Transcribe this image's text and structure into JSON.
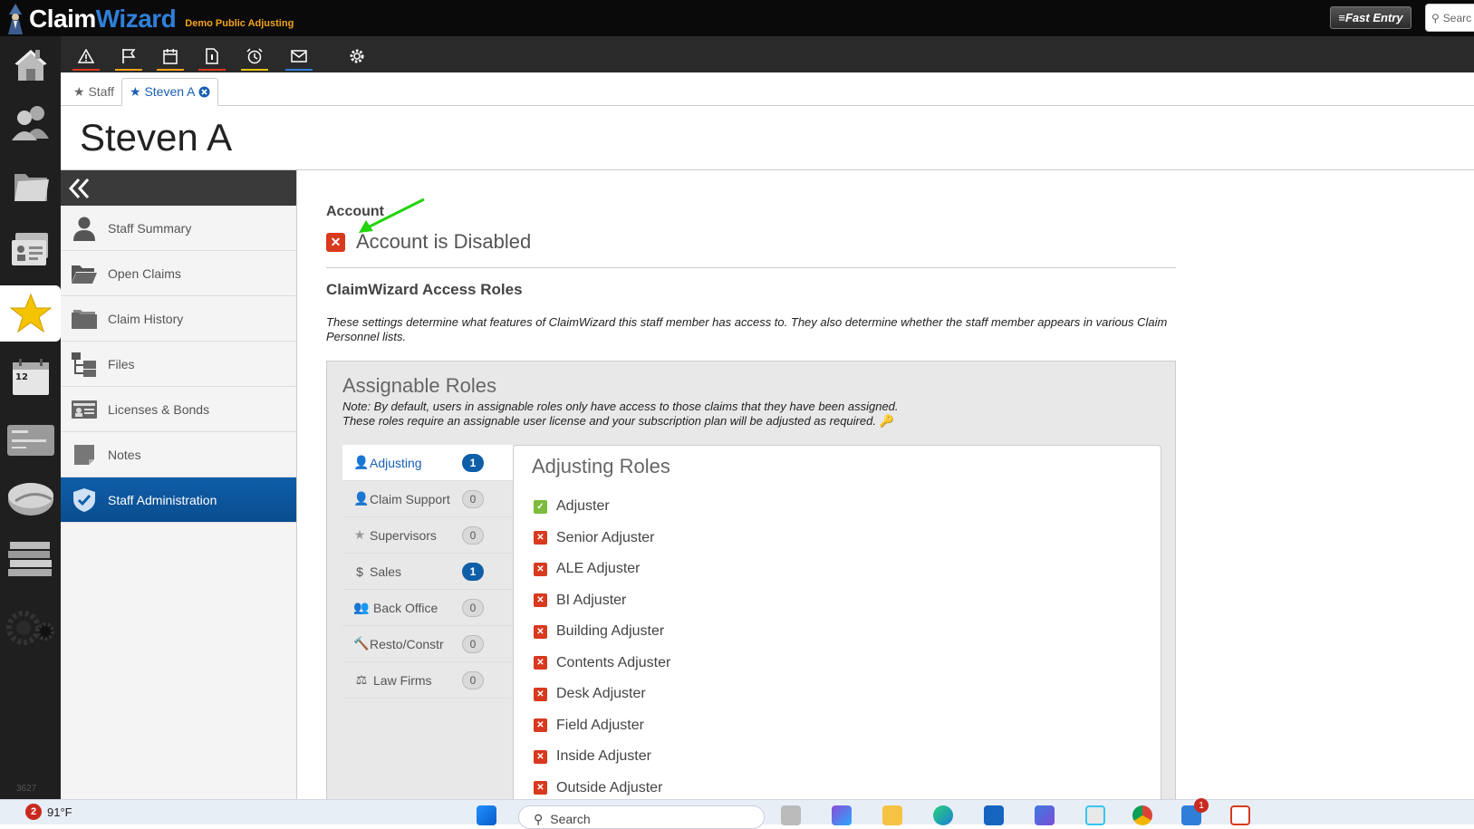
{
  "app": {
    "brand_part1": "Claim",
    "brand_part2": "Wizard",
    "company": "Demo Public Adjusting",
    "fast_entry_label": "≡Fast Entry",
    "search_placeholder": "Searc"
  },
  "left_nav": {
    "items": [
      "home-icon",
      "people-icon",
      "folder-icon",
      "contacts-icon",
      "star-icon",
      "calendar-icon",
      "bank-card-icon",
      "disk-icon",
      "books-icon",
      "gears-icon"
    ],
    "active": "star-icon",
    "calendar_day": "12",
    "version": "3627"
  },
  "toolbar": {
    "icons": [
      "alert-icon",
      "flag-icon",
      "calendar-icon",
      "document-icon",
      "alarm-icon",
      "mail-icon",
      "settings-icon"
    ],
    "colors": [
      "#d8391f",
      "#f2a31a",
      "#f2a31a",
      "#d8391f",
      "#e6c200",
      "#2f7fd8"
    ]
  },
  "tabs": {
    "staff_label": "★ Staff",
    "current_label": "★ Steven A"
  },
  "page_title": "Steven A",
  "side_menu": {
    "items": [
      {
        "label": "Staff Summary",
        "icon": "person-icon"
      },
      {
        "label": "Open Claims",
        "icon": "open-folder-icon"
      },
      {
        "label": "Claim History",
        "icon": "folders-icon"
      },
      {
        "label": "Files",
        "icon": "file-tree-icon"
      },
      {
        "label": "Licenses & Bonds",
        "icon": "id-card-icon"
      },
      {
        "label": "Notes",
        "icon": "note-icon"
      },
      {
        "label": "Staff Administration",
        "icon": "shield-check-icon"
      }
    ],
    "active_index": 6
  },
  "account": {
    "heading": "Account",
    "status": "Account is Disabled",
    "status_color": "#d8391f"
  },
  "access_roles": {
    "heading": "ClaimWizard Access Roles",
    "description": "These settings determine what features of ClaimWizard this staff member has access to. They also determine whether the staff member appears in various Claim Personnel lists."
  },
  "assignable": {
    "heading": "Assignable Roles",
    "note1": "Note: By default, users in assignable roles only have access to those claims that they have been assigned.",
    "note2": "These roles require an assignable user license and your subscription plan will be adjusted as required.",
    "tabs": [
      {
        "label": "Adjusting",
        "icon": "person-icon",
        "count": "1",
        "active": true
      },
      {
        "label": "Claim Support",
        "icon": "person-icon",
        "count": "0",
        "active": false
      },
      {
        "label": "Supervisors",
        "icon": "star-icon",
        "count": "0",
        "active": false
      },
      {
        "label": "Sales",
        "icon": "dollar-icon",
        "count": "1",
        "active": false
      },
      {
        "label": "Back Office",
        "icon": "group-icon",
        "count": "0",
        "active": false
      },
      {
        "label": "Resto/Constr",
        "icon": "hammer-icon",
        "count": "0",
        "active": false
      },
      {
        "label": "Law Firms",
        "icon": "scales-icon",
        "count": "0",
        "active": false
      }
    ],
    "roles_heading": "Adjusting Roles",
    "roles": [
      {
        "label": "Adjuster",
        "checked": true
      },
      {
        "label": "Senior Adjuster",
        "checked": false
      },
      {
        "label": "ALE Adjuster",
        "checked": false
      },
      {
        "label": "BI Adjuster",
        "checked": false
      },
      {
        "label": "Building Adjuster",
        "checked": false
      },
      {
        "label": "Contents Adjuster",
        "checked": false
      },
      {
        "label": "Desk Adjuster",
        "checked": false
      },
      {
        "label": "Field Adjuster",
        "checked": false
      },
      {
        "label": "Inside Adjuster",
        "checked": false
      },
      {
        "label": "Outside Adjuster",
        "checked": false
      }
    ]
  },
  "taskbar": {
    "weather_badge": "2",
    "temperature": "91°F",
    "search_label": "Search",
    "notification_badge": "1"
  }
}
